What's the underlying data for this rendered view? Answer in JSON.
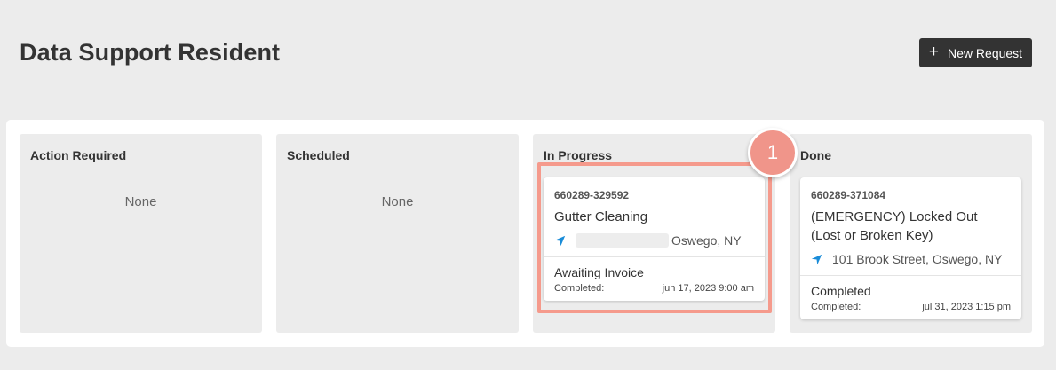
{
  "header": {
    "title": "Data Support Resident",
    "new_request_icon": "plus-icon",
    "new_request_label": "New Request"
  },
  "columns": [
    {
      "title": "Action Required",
      "empty_text": "None"
    },
    {
      "title": "Scheduled",
      "empty_text": "None"
    },
    {
      "title": "In Progress",
      "card": {
        "id": "660289-329592",
        "title": "Gutter Cleaning",
        "address": "Oswego, NY",
        "status": "Awaiting Invoice",
        "completed_label": "Completed:",
        "completed_value": "jun 17, 2023 9:00 am"
      }
    },
    {
      "title": "Done",
      "card": {
        "id": "660289-371084",
        "title": "(EMERGENCY) Locked Out (Lost or Broken Key)",
        "address": "101 Brook Street, Oswego, NY",
        "status": "Completed",
        "completed_label": "Completed:",
        "completed_value": "jul 31, 2023 1:15 pm"
      }
    }
  ],
  "annotation": {
    "step_number": "1"
  },
  "colors": {
    "accent_dark": "#333333",
    "location_icon": "#1a8cd8",
    "highlight": "#f59a8c"
  }
}
